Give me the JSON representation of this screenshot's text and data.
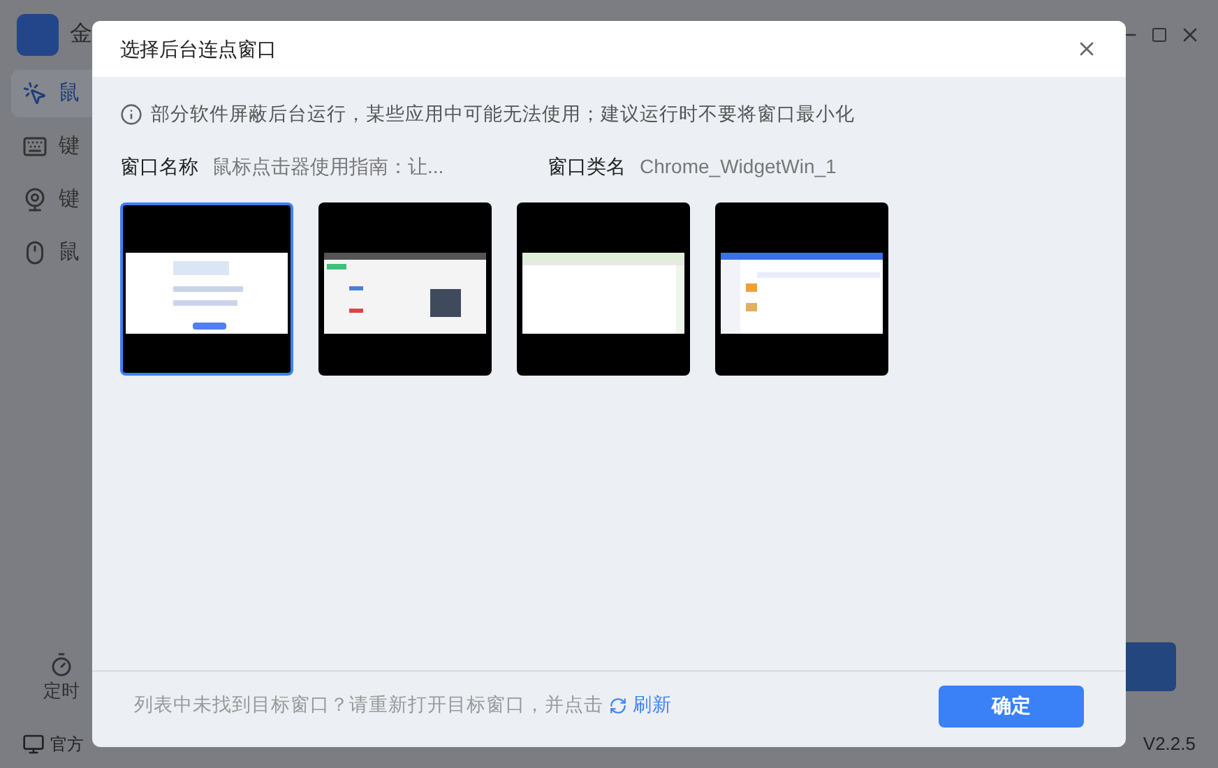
{
  "app": {
    "title": "金",
    "sidebar": [
      {
        "label": "鼠",
        "selected": true
      },
      {
        "label": "键",
        "selected": false
      },
      {
        "label": "键",
        "selected": false
      },
      {
        "label": "鼠",
        "selected": false
      }
    ],
    "timer": "定时",
    "footer_link": "官方",
    "version": "V2.2.5"
  },
  "dialog": {
    "title": "选择后台连点窗口",
    "notice": "部分软件屏蔽后台运行，某些应用中可能无法使用；建议运行时不要将窗口最小化",
    "window_name_label": "窗口名称",
    "window_name": "鼠标点击器使用指南：让...",
    "class_label": "窗口类名",
    "class_name": "Chrome_WidgetWin_1",
    "windows": [
      {
        "kind": "picture",
        "selected": true
      },
      {
        "kind": "picture",
        "selected": false
      },
      {
        "kind": "picture",
        "selected": false
      },
      {
        "kind": "picture",
        "selected": false
      }
    ],
    "hint": "列表中未找到目标窗口？请重新打开目标窗口，并点击",
    "refresh": "刷新",
    "confirm": "确定"
  }
}
